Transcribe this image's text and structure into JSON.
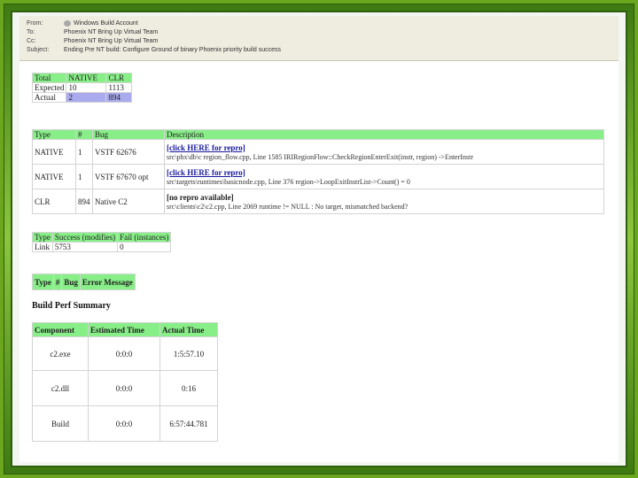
{
  "email": {
    "from_label": "From:",
    "from_value": "Windows Build Account",
    "to_label": "To:",
    "to_value": "Phoenix NT Bring Up Virtual Team",
    "cc_label": "Cc:",
    "cc_value": "Phoenix NT Bring Up Virtual Team",
    "subject_label": "Subject:",
    "subject_value": "Ending Pre NT build: Configure Ground of binary Phoenix priority build success"
  },
  "summary_table": {
    "headers": [
      "Total",
      "NATIVE",
      "CLR"
    ],
    "rows": [
      [
        "Expected",
        "10",
        "1113"
      ],
      [
        "Actual",
        "2",
        "894"
      ]
    ]
  },
  "bug_table": {
    "headers": [
      "Type",
      "#",
      "Bug",
      "Description"
    ],
    "rows": [
      {
        "type": "NATIVE",
        "num": "1",
        "bug": "VSTF 62676",
        "link": "[click HERE for repro]",
        "detail": "src\\phx\\db\\c region_flow.cpp, Line 1585 IRIRegionFlow::CheckRegionEnterExit(instr, region) ->EnterInstr"
      },
      {
        "type": "NATIVE",
        "num": "1",
        "bug": "VSTF 67670 opt",
        "link": "[click HERE for repro]",
        "detail": "src\\targets\\runtimes\\basicnode.cpp, Line 376 region->LoopExitInstrList->Count() = 0"
      },
      {
        "type": "CLR",
        "num": "894",
        "bug": "Native C2",
        "link": "[no repro available]",
        "detail": "src\\clients\\c2\\c2.cpp, Line 2069 runtime != NULL : No target, mismatched backend?"
      }
    ]
  },
  "link_table": {
    "headers": [
      "Type",
      "Success (modifies)",
      "Fail (instances)"
    ],
    "rows": [
      [
        "Link",
        "5753",
        "0"
      ]
    ]
  },
  "error_table": {
    "headers": [
      "Type",
      "#",
      "Bug",
      "Error Message"
    ]
  },
  "perf_title": "Build Perf Summary",
  "perf_table": {
    "headers": [
      "Component",
      "Estimated Time",
      "Actual Time"
    ],
    "rows": [
      [
        "c2.exe",
        "0:0:0",
        "1:5:57.10"
      ],
      [
        "c2.dll",
        "0:0:0",
        "0:16"
      ],
      [
        "Build",
        "0:0:0",
        "6:57:44.781"
      ]
    ]
  },
  "colors": {
    "header_green": "#88ee88",
    "highlight_blue": "#aaaaee",
    "frame_green": "#6aa61e"
  }
}
